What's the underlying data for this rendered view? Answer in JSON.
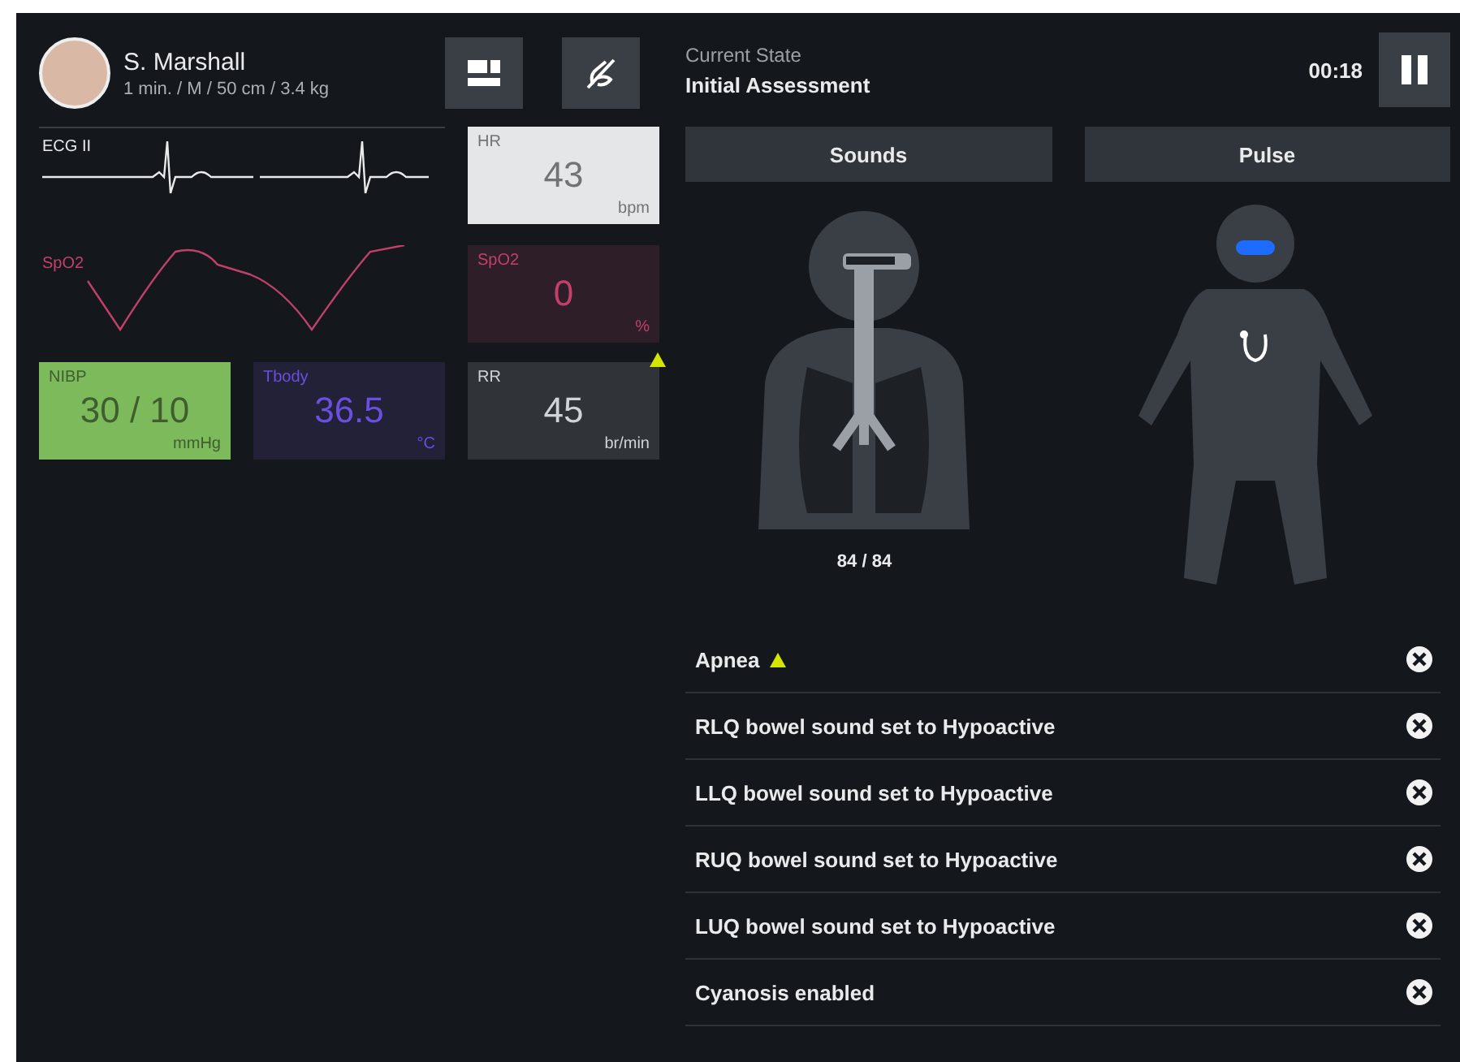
{
  "patient": {
    "name": "S. Marshall",
    "details": "1 min. / M / 50 cm / 3.4 kg"
  },
  "waveforms": [
    {
      "label": "ECG II",
      "kind": "ecg",
      "color": "#e8eaec"
    },
    {
      "label": "SpO2",
      "kind": "pleth",
      "color": "#c2406a"
    }
  ],
  "tiles": [
    {
      "label": "HR",
      "value": "43",
      "unit": "bpm",
      "kind": "light",
      "color": "#e4e6e8",
      "alarm": false
    },
    {
      "label": "SpO2",
      "value": "0",
      "unit": "%",
      "kind": "dark",
      "color": "#c2406a",
      "alarm": false
    },
    {
      "label": "NIBP",
      "value": "30 / 10",
      "unit": "mmHg",
      "kind": "light",
      "color": "#7dba5c",
      "alarm": false
    },
    {
      "label": "Tbody",
      "value": "36.5",
      "unit": "°C",
      "kind": "dark",
      "color": "#6a4fe0",
      "alarm": false
    },
    {
      "label": "RR",
      "value": "45",
      "unit": "br/min",
      "kind": "dark",
      "color": "#d0d4d8",
      "alarm": true
    }
  ],
  "state": {
    "caption": "Current State",
    "name": "Initial Assessment",
    "timer": "00:18"
  },
  "buttons": [
    "Sounds",
    "Pulse"
  ],
  "airway": {
    "reading": "84 / 84"
  },
  "events": [
    {
      "text": "Apnea",
      "alarm": true
    },
    {
      "text": "RLQ bowel sound set to Hypoactive",
      "alarm": false
    },
    {
      "text": "LLQ bowel sound set to Hypoactive",
      "alarm": false
    },
    {
      "text": "RUQ bowel sound set to Hypoactive",
      "alarm": false
    },
    {
      "text": "LUQ bowel sound set to Hypoactive",
      "alarm": false
    },
    {
      "text": "Cyanosis enabled",
      "alarm": false
    }
  ]
}
